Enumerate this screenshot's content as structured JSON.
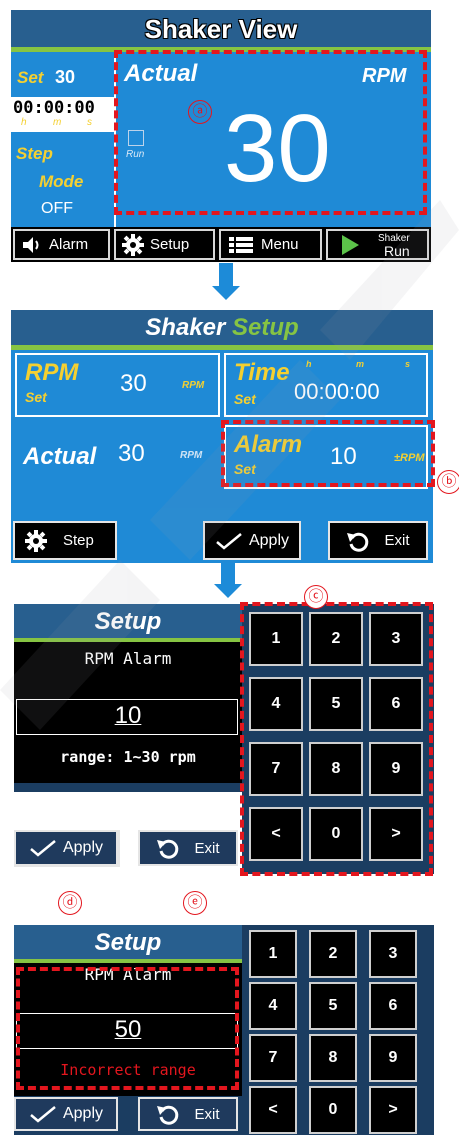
{
  "screen1": {
    "title": "Shaker View",
    "set_label": "Set",
    "set_value": "30",
    "time_value": "00:00:00",
    "time_units": [
      "h",
      "m",
      "s"
    ],
    "step_label": "Step",
    "mode_label": "Mode",
    "mode_value": "OFF",
    "actual_label": "Actual",
    "rpm_label": "RPM",
    "run_label": "Run",
    "actual_value": "30",
    "buttons": {
      "alarm": "Alarm",
      "setup": "Setup",
      "menu": "Menu",
      "shaker_small": "Shaker",
      "shaker_run": "Run"
    },
    "marker": "ⓐ"
  },
  "screen2": {
    "title_part1": "Shaker",
    "title_part2": "Setup",
    "rpm_label": "RPM",
    "rpm_set": "Set",
    "rpm_value": "30",
    "rpm_unit": "RPM",
    "time_label": "Time",
    "time_set": "Set",
    "time_units": [
      "h",
      "m",
      "s"
    ],
    "time_value": "00:00:00",
    "actual_label": "Actual",
    "actual_value": "30",
    "actual_unit": "RPM",
    "alarm_label": "Alarm",
    "alarm_set": "Set",
    "alarm_value": "10",
    "alarm_unit": "±RPM",
    "buttons": {
      "step": "Step",
      "apply": "Apply",
      "exit": "Exit"
    },
    "marker": "ⓑ"
  },
  "screen3": {
    "title": "Setup",
    "field_label": "RPM Alarm",
    "input_value": "10",
    "range_text": "range: 1~30 rpm",
    "buttons": {
      "apply": "Apply",
      "exit": "Exit"
    },
    "keys": [
      "1",
      "2",
      "3",
      "4",
      "5",
      "6",
      "7",
      "8",
      "9",
      "<",
      "0",
      ">"
    ],
    "marker_c": "ⓒ",
    "marker_d": "ⓓ",
    "marker_e": "ⓔ"
  },
  "screen4": {
    "title": "Setup",
    "field_label": "RPM Alarm",
    "input_value": "50",
    "error_text": "Incorrect range",
    "buttons": {
      "apply": "Apply",
      "exit": "Exit"
    },
    "keys": [
      "1",
      "2",
      "3",
      "4",
      "5",
      "6",
      "7",
      "8",
      "9",
      "<",
      "0",
      ">"
    ]
  },
  "colors": {
    "accent_blue": "#1f8ad6",
    "title_bar": "#285f8f",
    "green_line": "#86c443",
    "yellow_text": "#f4d031",
    "red_dash": "#e3161e",
    "dark_panel": "#1b3d61"
  }
}
